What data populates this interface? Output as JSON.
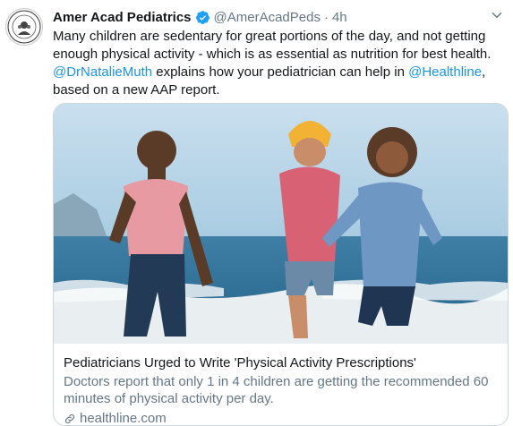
{
  "tweet": {
    "author_name": "Amer Acad Pediatrics",
    "handle": "@AmerAcadPeds",
    "separator": "·",
    "time": "4h",
    "text_part1": "Many children are sedentary for great portions of the day, and not getting enough physical activity - which is as essential as nutrition for best health. ",
    "mention1": "@DrNatalieMuth",
    "text_part2": " explains how your pediatrician can help in ",
    "mention2": "@Healthline",
    "text_part3": ", based on a new AAP report."
  },
  "card": {
    "title": "Pediatricians Urged to Write 'Physical Activity Prescriptions'",
    "description": "Doctors report that only 1 in 4 children are getting the recommended 60 minutes of physical activity per day.",
    "domain": "healthline.com"
  },
  "colors": {
    "link_blue": "#1b95e0",
    "secondary_gray": "#657786",
    "verified_blue": "#1da1f2"
  },
  "icons": {
    "verified": "verified-badge-icon",
    "more": "chevron-down-icon",
    "link": "link-icon"
  }
}
